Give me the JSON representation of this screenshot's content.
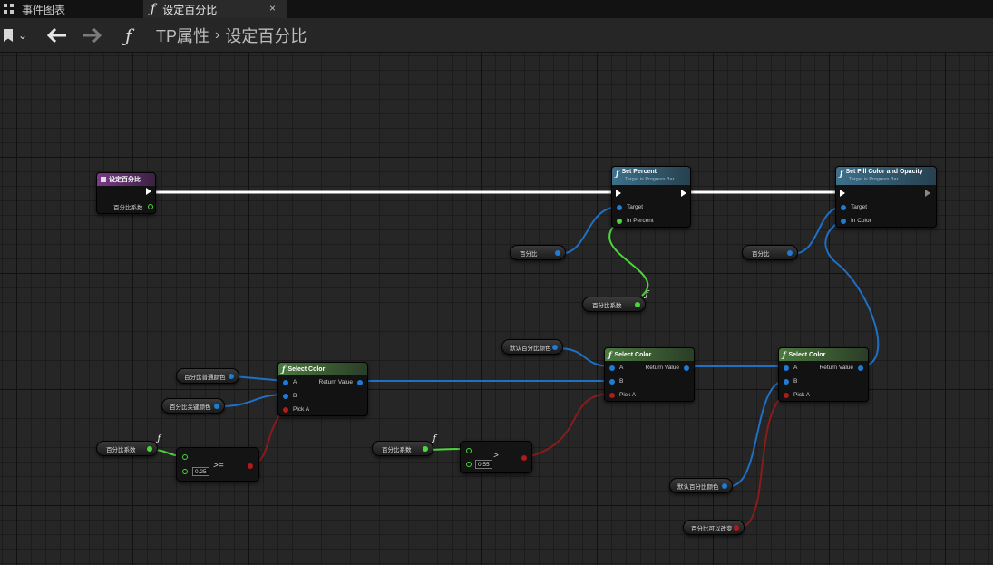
{
  "tabs": [
    {
      "label": "事件图表",
      "icon": "graph-grid-icon",
      "active": false
    },
    {
      "label": "设定百分比",
      "icon": "function-icon",
      "active": true,
      "close": "×"
    }
  ],
  "toolbar": {
    "bookmark_icon": "bookmark-icon",
    "dropdown_glyph": "⌄",
    "back_glyph": "🡐",
    "forward_glyph": "🡒",
    "function_glyph": "ƒ",
    "breadcrumbs": [
      "TP属性",
      "设定百分比"
    ],
    "separator": "›"
  },
  "graph": {
    "entry_node": {
      "title": "设定百分比",
      "param": "百分比系数"
    },
    "set_percent": {
      "title": "Set Percent",
      "subtitle": "Target is Progress Bar",
      "pins": [
        "Target",
        "In Percent"
      ]
    },
    "set_fill": {
      "title": "Set Fill Color and Opacity",
      "subtitle": "Target is Progress Bar",
      "pins": [
        "Target",
        "In Color"
      ]
    },
    "select_color_1": {
      "title": "Select Color",
      "pins": [
        "A",
        "B",
        "Pick A"
      ],
      "output": "Return Value"
    },
    "select_color_2": {
      "title": "Select Color",
      "pins": [
        "A",
        "B",
        "Pick A"
      ],
      "output": "Return Value"
    },
    "select_color_3": {
      "title": "Select Color",
      "pins": [
        "A",
        "B",
        "Pick A"
      ],
      "output": "Return Value"
    },
    "variables": {
      "percent_a": "百分比",
      "percent_b": "百分比",
      "coef_set_percent": "百分比系数",
      "default_color_1": "默认百分比颜色",
      "normal_color": "百分比普通颜色",
      "critical_color": "百分比关键颜色",
      "coef_cmp_1": "百分比系数",
      "coef_cmp_2": "百分比系数",
      "default_color_2": "默认百分比颜色",
      "can_change": "百分比可以改变"
    },
    "compare_1": {
      "value": "0.25",
      "op": ">="
    },
    "compare_2": {
      "value": "0.55",
      "op": ">"
    },
    "function_mark": "ƒ"
  },
  "colors": {
    "exec_wire": "#ffffff",
    "color_wire": "#1f6fc4",
    "float_wire": "#4bd63b",
    "bool_wire": "#8a1b1b",
    "function_header": "#3e6f8a",
    "pure_header": "#4b7a3f",
    "entry_header": "#7a3a8a"
  }
}
